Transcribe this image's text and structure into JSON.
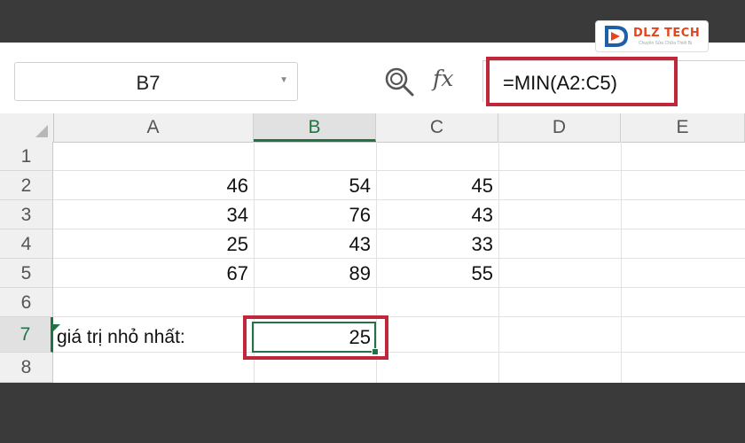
{
  "logo": {
    "text": "DLZ TECH",
    "subtext": "Chuyên Sửa Chữa Thiết Bị"
  },
  "formula_bar": {
    "name_box": "B7",
    "formula": "=MIN(A2:C5)",
    "zoom_icon": "zoom-icon",
    "fx_label": "fx"
  },
  "sheet": {
    "columns": [
      "A",
      "B",
      "C",
      "D",
      "E"
    ],
    "active_column": "B",
    "rows": [
      "1",
      "2",
      "3",
      "4",
      "5",
      "6",
      "7",
      "8"
    ],
    "active_row": "7",
    "cells": {
      "A2": "46",
      "B2": "54",
      "C2": "45",
      "A3": "34",
      "B3": "76",
      "C3": "43",
      "A4": "25",
      "B4": "43",
      "C4": "33",
      "A5": "67",
      "B5": "89",
      "C5": "55",
      "A7": "giá trị nhỏ nhất:",
      "B7": "25"
    }
  },
  "colors": {
    "accent_green": "#217346",
    "highlight_red": "#c0273a",
    "logo_orange": "#e8431a"
  }
}
